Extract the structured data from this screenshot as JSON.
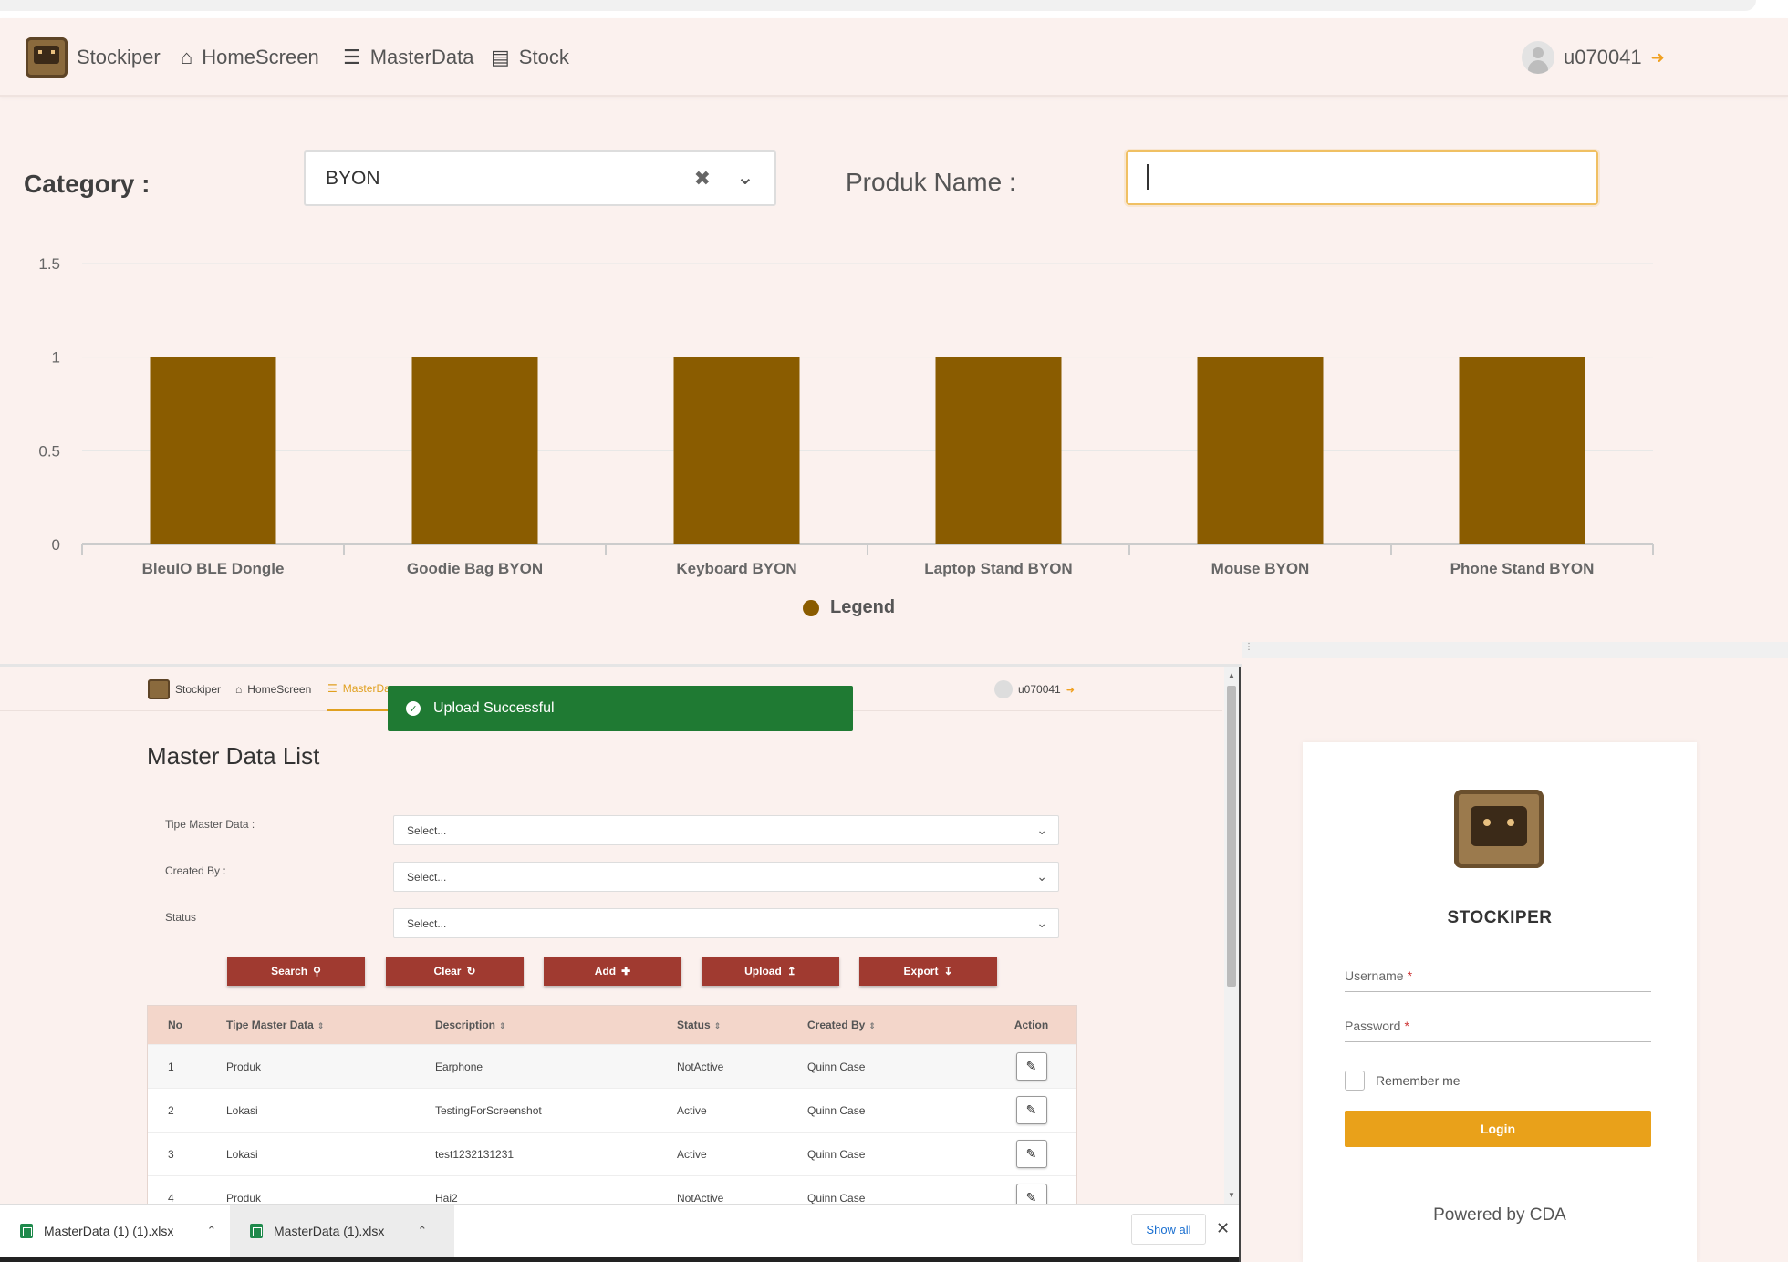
{
  "top_nav": {
    "brand": "Stockiper",
    "items": [
      {
        "label": "HomeScreen",
        "icon": "home-icon"
      },
      {
        "label": "MasterData",
        "icon": "database-icon"
      },
      {
        "label": "Stock",
        "icon": "box-icon"
      }
    ],
    "user": "u070041"
  },
  "filters": {
    "category_label": "Category :",
    "category_value": "BYON",
    "product_label": "Produk Name :",
    "product_value": ""
  },
  "chart_data": {
    "type": "bar",
    "categories": [
      "BleuIO BLE Dongle",
      "Goodie Bag BYON",
      "Keyboard BYON",
      "Laptop Stand BYON",
      "Mouse BYON",
      "Phone Stand BYON"
    ],
    "series": [
      {
        "name": "Legend",
        "values": [
          1,
          1,
          1,
          1,
          1,
          1
        ],
        "color": "#8a5c00"
      }
    ],
    "yticks": [
      "0",
      "0.5",
      "1",
      "1.5"
    ],
    "ylim": [
      0,
      1.5
    ],
    "grid": true,
    "legend": "bottom"
  },
  "master_data_window": {
    "nav": {
      "brand": "Stockiper",
      "home": "HomeScreen",
      "master": "MasterDa",
      "user": "u070041"
    },
    "toast": "Upload Successful",
    "title": "Master Data List",
    "filters": [
      {
        "label": "Tipe Master Data :",
        "value": "Select..."
      },
      {
        "label": "Created By :",
        "value": "Select..."
      },
      {
        "label": "Status",
        "value": "Select..."
      }
    ],
    "buttons": {
      "search": "Search",
      "clear": "Clear",
      "add": "Add",
      "upload": "Upload",
      "export": "Export"
    },
    "table": {
      "headers": [
        "No",
        "Tipe Master Data",
        "Description",
        "Status",
        "Created By",
        "Action"
      ],
      "rows": [
        [
          "1",
          "Produk",
          "Earphone",
          "NotActive",
          "Quinn Case"
        ],
        [
          "2",
          "Lokasi",
          "TestingForScreenshot",
          "Active",
          "Quinn Case"
        ],
        [
          "3",
          "Lokasi",
          "test1232131231",
          "Active",
          "Quinn Case"
        ],
        [
          "4",
          "Produk",
          "Hai2",
          "NotActive",
          "Quinn Case"
        ]
      ]
    }
  },
  "downloads": {
    "files": [
      "MasterData (1) (1).xlsx",
      "MasterData (1).xlsx"
    ],
    "show_all": "Show all"
  },
  "login": {
    "title": "STOCKIPER",
    "username_label": "Username",
    "password_label": "Password",
    "remember_label": "Remember me",
    "login_button": "Login",
    "powered": "Powered by CDA"
  }
}
